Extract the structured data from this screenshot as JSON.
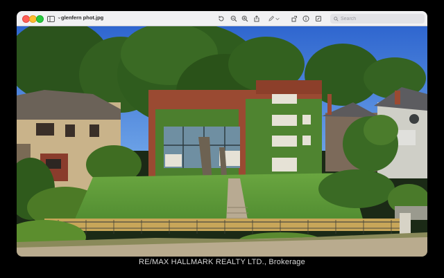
{
  "window": {
    "title": "glenfern phot.jpg",
    "search_placeholder": "Search",
    "toolbar_icons": [
      "rotate-icon",
      "zoom-out-icon",
      "zoom-in-icon",
      "share-icon",
      "markup-pen-icon",
      "chevron-down-icon",
      "rotate-crop-icon",
      "info-icon",
      "highlight-icon"
    ]
  },
  "caption": {
    "brokerage": "RE/MAX HALLMARK REALTY LTD., Brokerage"
  },
  "colors": {
    "sky": "#3f78d8",
    "foliage": "#2e5a1e",
    "lawn": "#5f9a3a",
    "ivy": "#4c7f2e",
    "brick": "#9a4a32"
  }
}
